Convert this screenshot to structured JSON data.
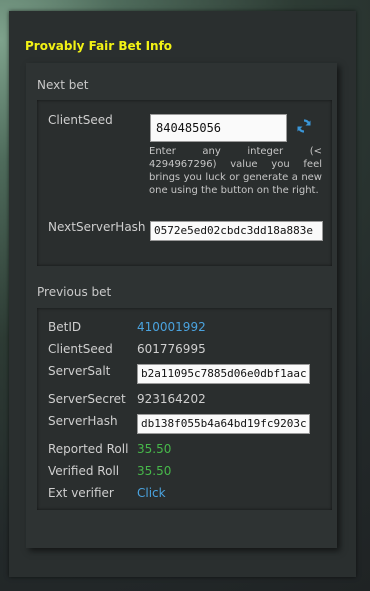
{
  "title": "Provably Fair Bet Info",
  "next_bet": {
    "heading": "Next bet",
    "client_seed_label": "ClientSeed",
    "client_seed_value": "840485056",
    "help_text": "Enter any integer (< 4294967296) value you feel brings you luck or generate a new one using the button on the right.",
    "next_server_hash_label": "NextServerHash",
    "next_server_hash_value": "0572e5ed02cbdc3dd18a883e"
  },
  "previous_bet": {
    "heading": "Previous bet",
    "bet_id_label": "BetID",
    "bet_id_value": "410001992",
    "client_seed_label": "ClientSeed",
    "client_seed_value": "601776995",
    "server_salt_label": "ServerSalt",
    "server_salt_value": "b2a11095c7885d06e0dbf1aac",
    "server_secret_label": "ServerSecret",
    "server_secret_value": "923164202",
    "server_hash_label": "ServerHash",
    "server_hash_value": "db138f055b4a64bd19fc9203c",
    "reported_roll_label": "Reported Roll",
    "reported_roll_value": "35.50",
    "verified_roll_label": "Verified Roll",
    "verified_roll_value": "35.50",
    "ext_verifier_label": "Ext verifier",
    "ext_verifier_link": "Click"
  },
  "colors": {
    "title": "#f2f215",
    "link": "#4aa3df",
    "roll": "#47b84a",
    "refresh_icon": "#3a96d8"
  },
  "icons": {
    "refresh": "refresh-icon"
  }
}
